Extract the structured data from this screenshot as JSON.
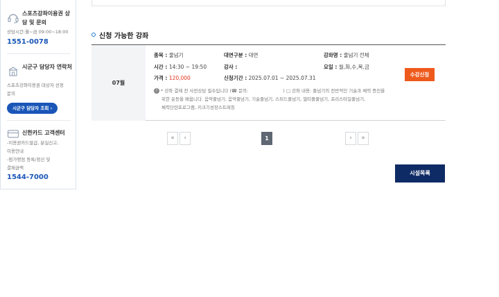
{
  "sidebar": {
    "consult": {
      "title": "스포츠강좌이용권 상담 및 문의",
      "hours": "상담시간:월~금 09:00~18:00",
      "phone": "1551-0078"
    },
    "district": {
      "title": "시군구 담당자 연락처",
      "desc": "스포츠강좌이용권 대상자 선정 문의",
      "button": "시군구 담당자 조회"
    },
    "card": {
      "title": "신한카드 고객센터",
      "desc1": "-이용권카드발급, 분실신고,",
      "desc2": "이용안내",
      "desc3": "-펌가맹점 등록/정산 및",
      "desc4": "결제금액",
      "phone": "1544-7000"
    }
  },
  "section": {
    "title": "신청 가능한 강좌"
  },
  "course": {
    "month": "07월",
    "category_label": "종목 :",
    "category": "줄넘기",
    "mode_label": "대면구분 :",
    "mode": "대면",
    "name_label": "강좌명 :",
    "name": "줄넘기 전체",
    "time_label": "시간 :",
    "time": "14:30 ~ 19:50",
    "teacher_label": "강사 :",
    "teacher": "",
    "days_label": "요일 :",
    "days": "월,화,수,목,금",
    "price_label": "가격 :",
    "price": "120,000",
    "period_label": "신청기간 :",
    "period": "2025.07.01 ~ 2025.07.31",
    "note1a": "* 강좌 결제 전 사전상담 필수입니다 (☎ 문의:",
    "note1b": ") □ 강좌 내용: 줄넘기의 전반적인 기술과 체력 증진을",
    "note2": "위한 운동을 배웁니다. 음악줄넘기, 음악줄넘기, 기술줄넘기, 스피드줄넘기, 멀티플줄넘기, 프리스타일줄넘기,",
    "note3": "체력단련프로그램, 키크기성장스트레칭",
    "apply_button": "수강신청"
  },
  "pagination": {
    "first": "«",
    "prev": "‹",
    "current": "1",
    "next": "›",
    "last": "»"
  },
  "footer": {
    "list_button": "시설목록"
  }
}
